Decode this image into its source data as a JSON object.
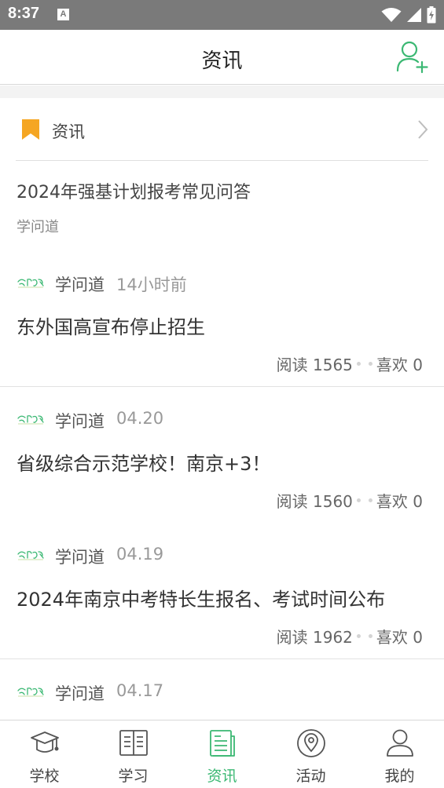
{
  "status_bar": {
    "time": "8:37",
    "notification": "A"
  },
  "header": {
    "title": "资讯"
  },
  "section": {
    "label": "资讯"
  },
  "featured": {
    "title": "2024年强基计划报考常见问答",
    "source": "学问道"
  },
  "articles": [
    {
      "author": "学问道",
      "time": "14小时前",
      "title": "东外国高宣布停止招生",
      "reads_label": "阅读 1565",
      "likes_label": "喜欢 0"
    },
    {
      "author": "学问道",
      "time": "04.20",
      "title": "省级综合示范学校！南京+3！",
      "reads_label": "阅读 1560",
      "likes_label": "喜欢 0"
    },
    {
      "author": "学问道",
      "time": "04.19",
      "title": "2024年南京中考特长生报名、考试时间公布",
      "reads_label": "阅读 1962",
      "likes_label": "喜欢 0"
    },
    {
      "author": "学问道",
      "time": "04.17",
      "title": "",
      "reads_label": "",
      "likes_label": ""
    }
  ],
  "nav": [
    {
      "label": "学校",
      "icon": "graduation-cap-icon"
    },
    {
      "label": "学习",
      "icon": "book-icon"
    },
    {
      "label": "资讯",
      "icon": "news-icon",
      "active": true
    },
    {
      "label": "活动",
      "icon": "location-pin-icon"
    },
    {
      "label": "我的",
      "icon": "user-icon"
    }
  ],
  "colors": {
    "accent": "#3bb873",
    "bookmark": "#f5a623",
    "status_bar": "#7a7a7a"
  }
}
